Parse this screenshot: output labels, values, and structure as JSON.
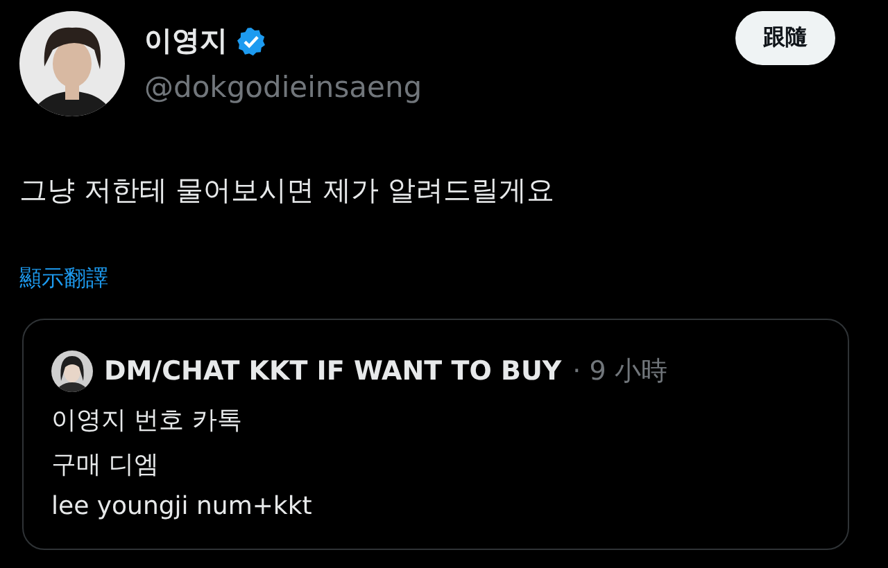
{
  "author": {
    "name": "이영지",
    "verified": true,
    "handle": "@dokgodieinsaeng"
  },
  "follow_button": {
    "label": "跟隨"
  },
  "tweet_text": "그냥 저한테 물어보시면 제가 알려드릴게요",
  "translate_link": "顯示翻譯",
  "quoted_tweet": {
    "author": "DM/CHAT KKT IF WANT TO BUY",
    "time": "· 9 小時",
    "lines": [
      "이영지 번호 카톡",
      "구매 디엠",
      "lee youngji num+kkt"
    ]
  }
}
